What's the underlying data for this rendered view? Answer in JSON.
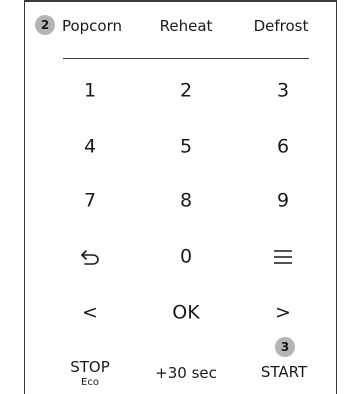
{
  "function_keys": {
    "badge_1": "2",
    "popcorn": "Popcorn",
    "reheat": "Reheat",
    "defrost": "Defrost"
  },
  "keypad": {
    "k1": "1",
    "k2": "2",
    "k3": "3",
    "k4": "4",
    "k5": "5",
    "k6": "6",
    "k7": "7",
    "k8": "8",
    "k9": "9",
    "k0": "0",
    "back_icon": "back-arrow-icon",
    "menu_icon": "menu-icon",
    "left": "<",
    "ok": "OK",
    "right": ">"
  },
  "controls": {
    "stop": "STOP",
    "eco": "Eco",
    "plus30": "+30 sec",
    "badge_3": "3",
    "start": "START"
  }
}
